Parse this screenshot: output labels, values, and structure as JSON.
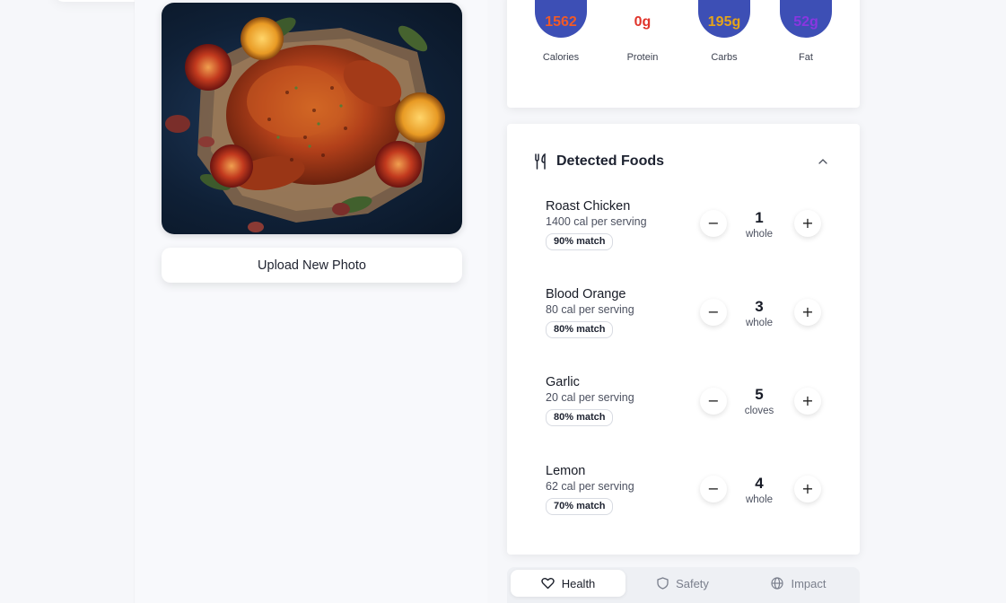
{
  "upload_button_label": "Upload New Photo",
  "photo": {
    "alt": "Roast chicken with blood oranges and lemons on parchment"
  },
  "macros": [
    {
      "value": "1562",
      "label": "Calories",
      "color": "#f05a28",
      "bg": "#3d4fb5"
    },
    {
      "value": "0g",
      "label": "Protein",
      "color": "#e0342b",
      "bg": "#ffffff"
    },
    {
      "value": "195g",
      "label": "Carbs",
      "color": "#e5a41a",
      "bg": "#3d4fb5"
    },
    {
      "value": "52g",
      "label": "Fat",
      "color": "#8a36e0",
      "bg": "#3d4fb5"
    }
  ],
  "foods_section": {
    "title": "Detected Foods"
  },
  "foods": [
    {
      "name": "Roast Chicken",
      "cal": "1400 cal per serving",
      "match": "90% match",
      "qty": "1",
      "unit": "whole"
    },
    {
      "name": "Blood Orange",
      "cal": "80 cal per serving",
      "match": "80% match",
      "qty": "3",
      "unit": "whole"
    },
    {
      "name": "Garlic",
      "cal": "20 cal per serving",
      "match": "80% match",
      "qty": "5",
      "unit": "cloves"
    },
    {
      "name": "Lemon",
      "cal": "62 cal per serving",
      "match": "70% match",
      "qty": "4",
      "unit": "whole"
    }
  ],
  "stepper": {
    "minus": "−",
    "plus": "+"
  },
  "tabs": [
    {
      "label": "Health",
      "icon": "heart-icon"
    },
    {
      "label": "Safety",
      "icon": "shield-icon"
    },
    {
      "label": "Impact",
      "icon": "globe-icon"
    }
  ]
}
